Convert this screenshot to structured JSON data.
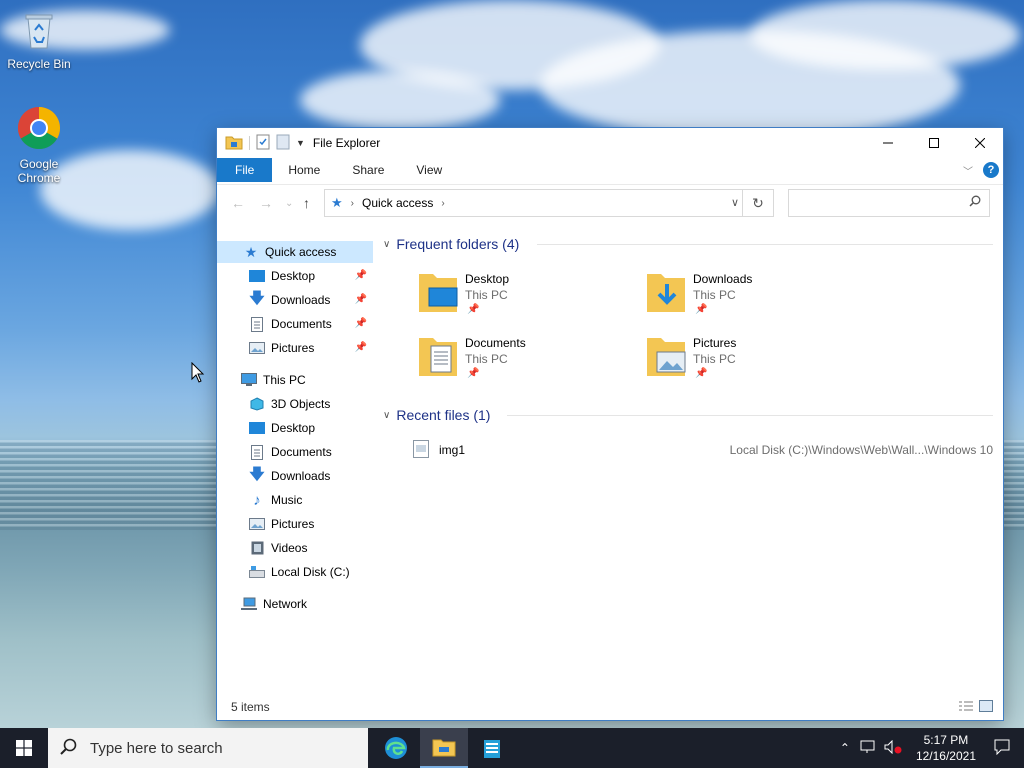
{
  "desktop": {
    "icons": [
      {
        "label": "Recycle Bin",
        "icon": "recycle-bin-icon"
      },
      {
        "label": "Google Chrome",
        "icon": "chrome-icon"
      }
    ]
  },
  "window": {
    "title": "File Explorer",
    "ribbon_tabs": [
      "File",
      "Home",
      "Share",
      "View"
    ],
    "address": {
      "crumb": "Quick access"
    },
    "search_placeholder": ""
  },
  "navpane": {
    "quick_access": "Quick access",
    "quick_items": [
      "Desktop",
      "Downloads",
      "Documents",
      "Pictures"
    ],
    "this_pc": "This PC",
    "pc_items": [
      "3D Objects",
      "Desktop",
      "Documents",
      "Downloads",
      "Music",
      "Pictures",
      "Videos",
      "Local Disk (C:)"
    ],
    "network": "Network"
  },
  "content": {
    "frequent_header": "Frequent folders (4)",
    "folders": [
      {
        "name": "Desktop",
        "location": "This PC"
      },
      {
        "name": "Downloads",
        "location": "This PC"
      },
      {
        "name": "Documents",
        "location": "This PC"
      },
      {
        "name": "Pictures",
        "location": "This PC"
      }
    ],
    "recent_header": "Recent files (1)",
    "recent": [
      {
        "name": "img1",
        "path": "Local Disk (C:)\\Windows\\Web\\Wall...\\Windows 10"
      }
    ]
  },
  "status": {
    "items": "5 items"
  },
  "taskbar": {
    "search_text": "Type here to search",
    "time": "5:17 PM",
    "date": "12/16/2021"
  },
  "colors": {
    "accent": "#1979ca",
    "selection": "#cce8ff",
    "taskbar": "#1b1f2a"
  }
}
